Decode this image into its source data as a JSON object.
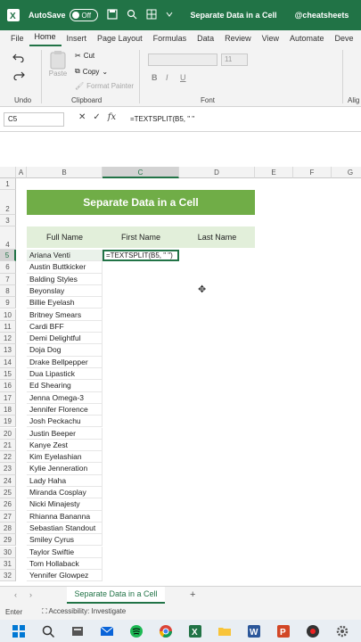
{
  "titlebar": {
    "autosave_label": "AutoSave",
    "autosave_state": "Off",
    "doc_title": "Separate Data in a Cell",
    "handle": "@cheatsheets"
  },
  "tabs": [
    "File",
    "Home",
    "Insert",
    "Page Layout",
    "Formulas",
    "Data",
    "Review",
    "View",
    "Automate",
    "Deve"
  ],
  "ribbon": {
    "undo_group": "Undo",
    "clipboard_group": "Clipboard",
    "font_group": "Font",
    "align_group": "Alig",
    "paste": "Paste",
    "cut": "Cut",
    "copy": "Copy",
    "format_painter": "Format Painter",
    "font_size": "11",
    "bold": "B",
    "italic": "I",
    "underline": "U"
  },
  "formula_bar": {
    "name_box": "C5",
    "formula": "=TEXTSPLIT(B5, \" \""
  },
  "columns": [
    "A",
    "B",
    "C",
    "D",
    "E",
    "F",
    "G"
  ],
  "rows": [
    "1",
    "2",
    "3",
    "4",
    "5",
    "6",
    "7",
    "8",
    "9",
    "10",
    "11",
    "12",
    "13",
    "14",
    "15",
    "16",
    "17",
    "18",
    "19",
    "20",
    "21",
    "22",
    "23",
    "24",
    "25",
    "26",
    "27",
    "28",
    "29",
    "30",
    "31",
    "32"
  ],
  "sheet": {
    "title": "Separate Data in a Cell",
    "headers": [
      "Full Name",
      "First Name",
      "Last Name"
    ],
    "active_cell_text": "=TEXTSPLIT(B5, \" \")",
    "names": [
      "Ariana Venti",
      "Austin Buttkicker",
      "Balding Styles",
      "Beyonslay",
      "Billie Eyelash",
      "Britney Smears",
      "Cardi BFF",
      "Demi Delightful",
      "Doja Dog",
      "Drake Bellpepper",
      "Dua Lipastick",
      "Ed Shearing",
      "Jenna Omega-3",
      "Jennifer Florence",
      "Josh Peckachu",
      "Justin Beeper",
      "Kanye Zest",
      "Kim Eyelashian",
      "Kylie Jenneration",
      "Lady Haha",
      "Miranda Cosplay",
      "Nicki Minajesty",
      "Rhianna Bananna",
      "Sebastian Standout",
      "Smiley Cyrus",
      "Taylor Swiftie",
      "Tom Hollaback",
      "Yennifer Glowpez"
    ]
  },
  "sheet_tabs": {
    "active": "Separate Data in a Cell",
    "add": "+"
  },
  "status": {
    "mode": "Enter",
    "accessibility": "Accessibility: Investigate"
  },
  "colors": {
    "brand": "#217346",
    "title_band": "#70ad47",
    "header_band": "#e2efda"
  },
  "taskbar_icons": [
    "windows-icon",
    "search-icon",
    "files-icon",
    "mail-icon",
    "spotify-icon",
    "chrome-icon",
    "excel-icon",
    "folder-icon",
    "word-icon",
    "powerpoint-icon",
    "media-icon",
    "settings-icon"
  ]
}
